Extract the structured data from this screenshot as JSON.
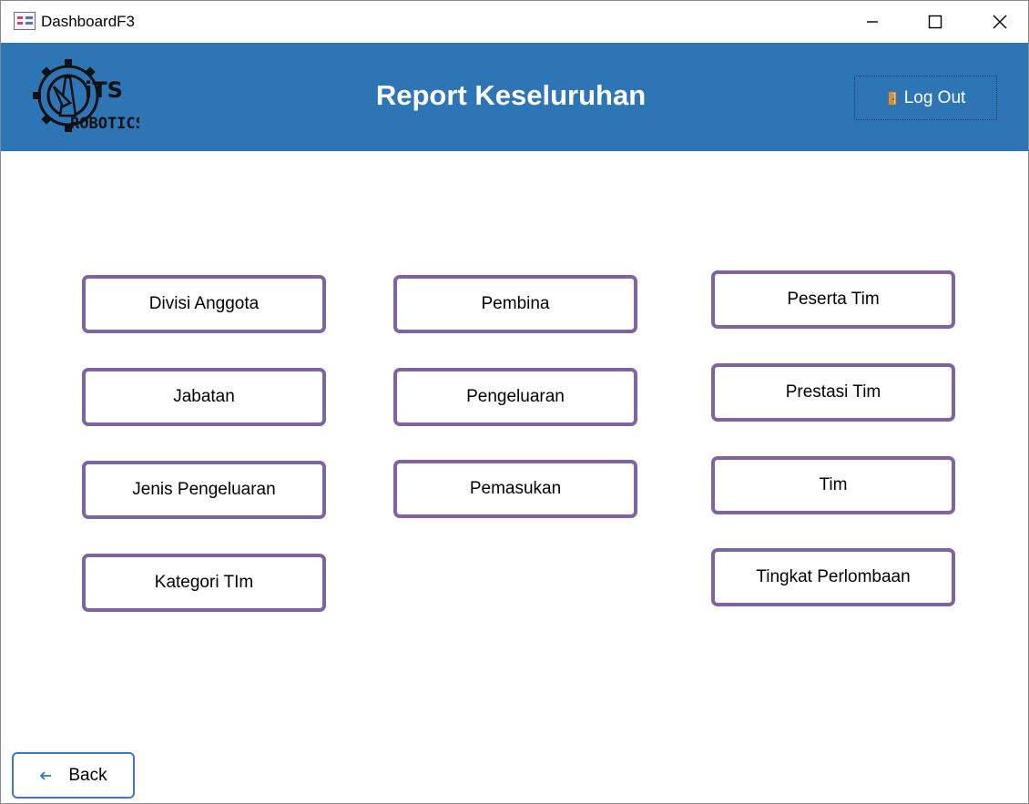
{
  "window": {
    "title": "DashboardF3"
  },
  "header": {
    "title": "Report Keseluruhan",
    "logout_label": "Log Out",
    "logo_text_top": "iTS",
    "logo_text_bottom": "ROBOTICS"
  },
  "menu": {
    "col1": [
      "Divisi Anggota",
      "Jabatan",
      "Jenis Pengeluaran",
      "Kategori TIm"
    ],
    "col2": [
      "Pembina",
      "Pengeluaran",
      "Pemasukan"
    ],
    "col3": [
      "Peserta Tim",
      "Prestasi Tim",
      "Tim",
      "Tingkat Perlombaan"
    ]
  },
  "footer": {
    "back_label": "Back"
  },
  "colors": {
    "header": "#2e75b6",
    "button_border": "#8064a2",
    "back_border": "#3f78c2"
  }
}
